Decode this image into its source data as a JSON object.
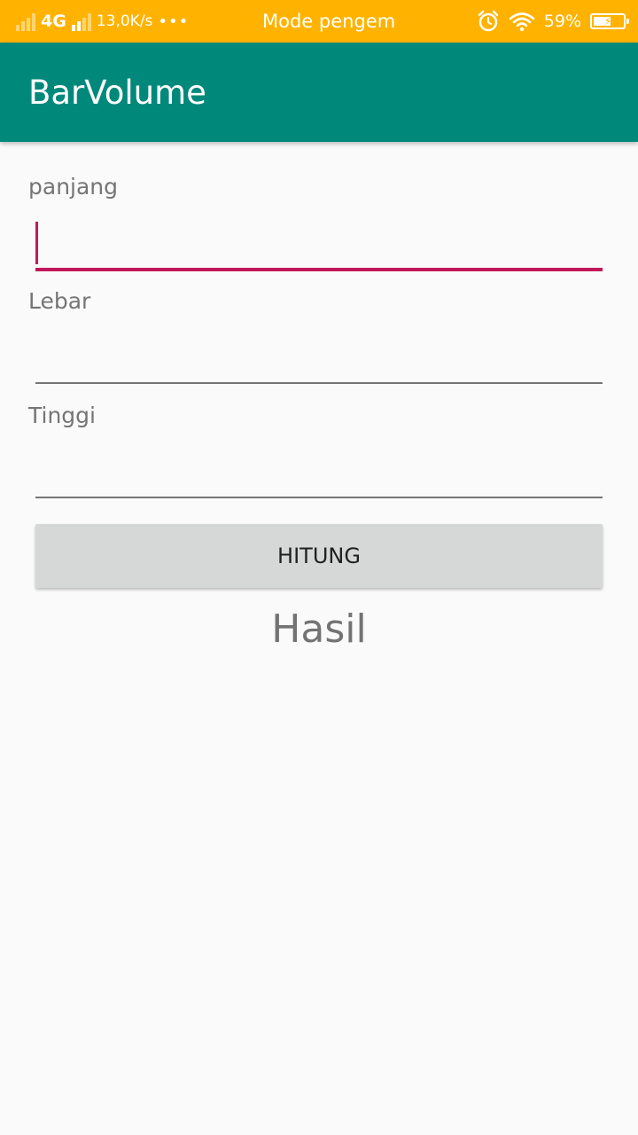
{
  "status_bar": {
    "network_type": "4G",
    "net_speed": "13,0K/s",
    "more": "•••",
    "notification_text": "Mode pengembang",
    "icons": [
      "signal-icon",
      "signal-icon",
      "alarm-clock-icon",
      "wifi-icon",
      "battery-charging-icon"
    ],
    "battery_percent": "59%",
    "battery_level": 0.59,
    "background_color": "#ffb300"
  },
  "app_bar": {
    "title": "BarVolume",
    "background_color": "#00897b"
  },
  "form": {
    "fields": [
      {
        "label": "panjang",
        "value": "",
        "focused": true
      },
      {
        "label": "Lebar",
        "value": "",
        "focused": false
      },
      {
        "label": "Tinggi",
        "value": "",
        "focused": false
      }
    ],
    "accent_color": "#c2185b"
  },
  "button": {
    "label": "HITUNG"
  },
  "result": {
    "text": "Hasil"
  }
}
